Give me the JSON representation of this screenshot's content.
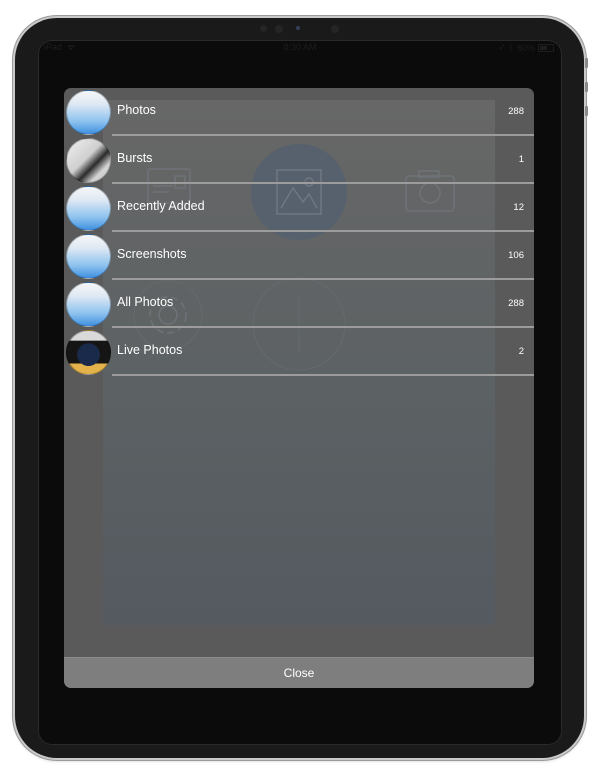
{
  "device": {
    "model": "iPad"
  },
  "status_bar": {
    "carrier": "iPad",
    "wifi_icon": "wifi-icon",
    "time": "8:30 AM",
    "location_icon": "location-arrow-icon",
    "bluetooth_icon": "bluetooth-icon",
    "battery_percent": "60%",
    "battery_level": 0.6
  },
  "album_picker": {
    "albums": [
      {
        "name": "Photos",
        "count": "288",
        "thumbnail": "blue-placeholder"
      },
      {
        "name": "Bursts",
        "count": "1",
        "thumbnail": "burst-photo"
      },
      {
        "name": "Recently Added",
        "count": "12",
        "thumbnail": "blue-placeholder"
      },
      {
        "name": "Screenshots",
        "count": "106",
        "thumbnail": "blue-placeholder"
      },
      {
        "name": "All Photos",
        "count": "288",
        "thumbnail": "blue-placeholder"
      },
      {
        "name": "Live Photos",
        "count": "2",
        "thumbnail": "live-photo"
      }
    ],
    "close_label": "Close"
  },
  "background_icons": [
    "id-card-icon",
    "image-icon",
    "camera-icon",
    "gear-icon",
    "add-circle-icon"
  ],
  "colors": {
    "panel": "#5a5a5a",
    "close_bar": "#7e7e7e",
    "separator": "#9c9c9c",
    "text": "#ffffff"
  }
}
